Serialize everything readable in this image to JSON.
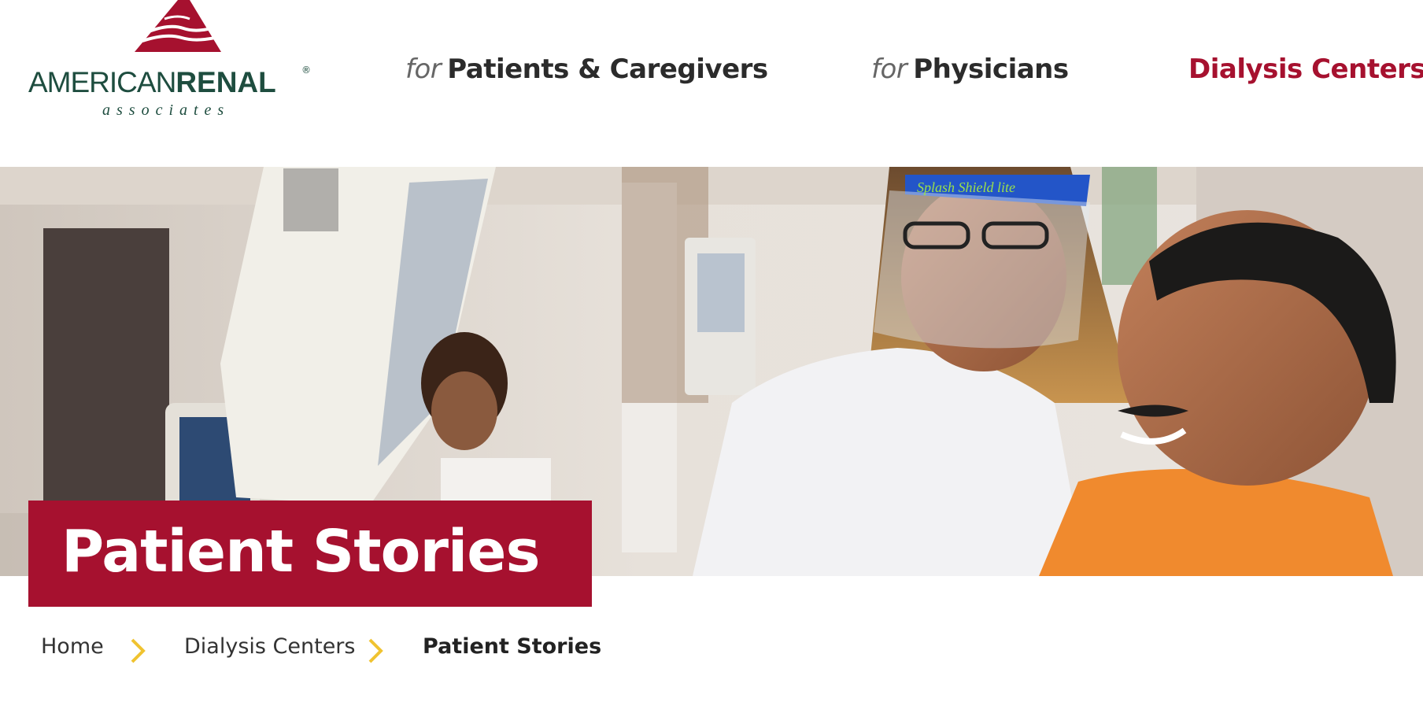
{
  "header": {
    "logo": {
      "wordmark_light": "AMERICAN",
      "wordmark_bold": "RENAL",
      "registered": "®",
      "tagline": "associates"
    },
    "nav": [
      {
        "prefix": "for",
        "label": "Patients & Caregivers"
      },
      {
        "prefix": "for",
        "label": "Physicians"
      },
      {
        "prefix": "",
        "label": "Dialysis Centers"
      }
    ]
  },
  "hero": {
    "title": "Patient Stories",
    "face_shield_text": "Splash Shield lite"
  },
  "breadcrumb": {
    "items": [
      "Home",
      "Dialysis Centers",
      "Patient Stories"
    ],
    "separator_icon": "chevron-right-icon"
  },
  "colors": {
    "brand_red": "#a6112f",
    "logo_green": "#1e4d3f",
    "chevron_yellow": "#f0c330",
    "nav_text": "#2b2b2b"
  }
}
